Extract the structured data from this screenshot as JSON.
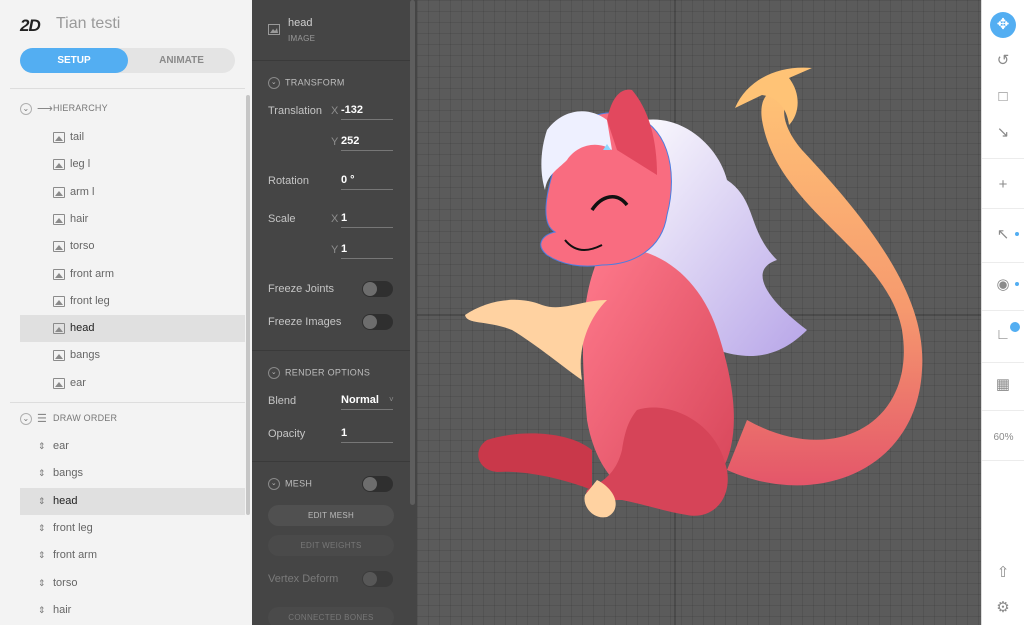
{
  "app": {
    "logo": "2D",
    "project_title": "Tian testi"
  },
  "mode": {
    "setup": "SETUP",
    "animate": "ANIMATE"
  },
  "hierarchy": {
    "title": "HIERARCHY",
    "items": [
      "tail",
      "leg l",
      "arm l",
      "hair",
      "torso",
      "front arm",
      "front leg",
      "head",
      "bangs",
      "ear"
    ],
    "selected": "head"
  },
  "draw_order": {
    "title": "DRAW ORDER",
    "items": [
      "ear",
      "bangs",
      "head",
      "front leg",
      "front arm",
      "torso",
      "hair"
    ],
    "selected": "head"
  },
  "inspector": {
    "name": "head",
    "type": "IMAGE",
    "transform": {
      "title": "TRANSFORM",
      "translation_label": "Translation",
      "tx_axis": "X",
      "tx": "-132",
      "ty_axis": "Y",
      "ty": "252",
      "rotation_label": "Rotation",
      "rotation": "0 °",
      "scale_label": "Scale",
      "sx_axis": "X",
      "sx": "1",
      "sy_axis": "Y",
      "sy": "1",
      "freeze_joints": "Freeze Joints",
      "freeze_images": "Freeze Images"
    },
    "render": {
      "title": "RENDER OPTIONS",
      "blend_label": "Blend",
      "blend": "Normal",
      "opacity_label": "Opacity",
      "opacity": "1"
    },
    "mesh": {
      "title": "MESH",
      "edit_mesh": "EDIT MESH",
      "edit_weights": "EDIT WEIGHTS",
      "vertex_deform": "Vertex Deform",
      "connected_bones": "CONNECTED BONES"
    }
  },
  "toolbar": {
    "zoom": "60%",
    "icons": [
      "move-icon",
      "rotate-icon",
      "scale-icon",
      "skew-icon",
      "add-icon",
      "select-icon",
      "visibility-icon",
      "axis-icon",
      "grid-icon",
      "export-icon",
      "settings-icon"
    ]
  },
  "colors": {
    "accent": "#53aef2",
    "canvas": "#5b5b5b",
    "panel": "#454545"
  }
}
